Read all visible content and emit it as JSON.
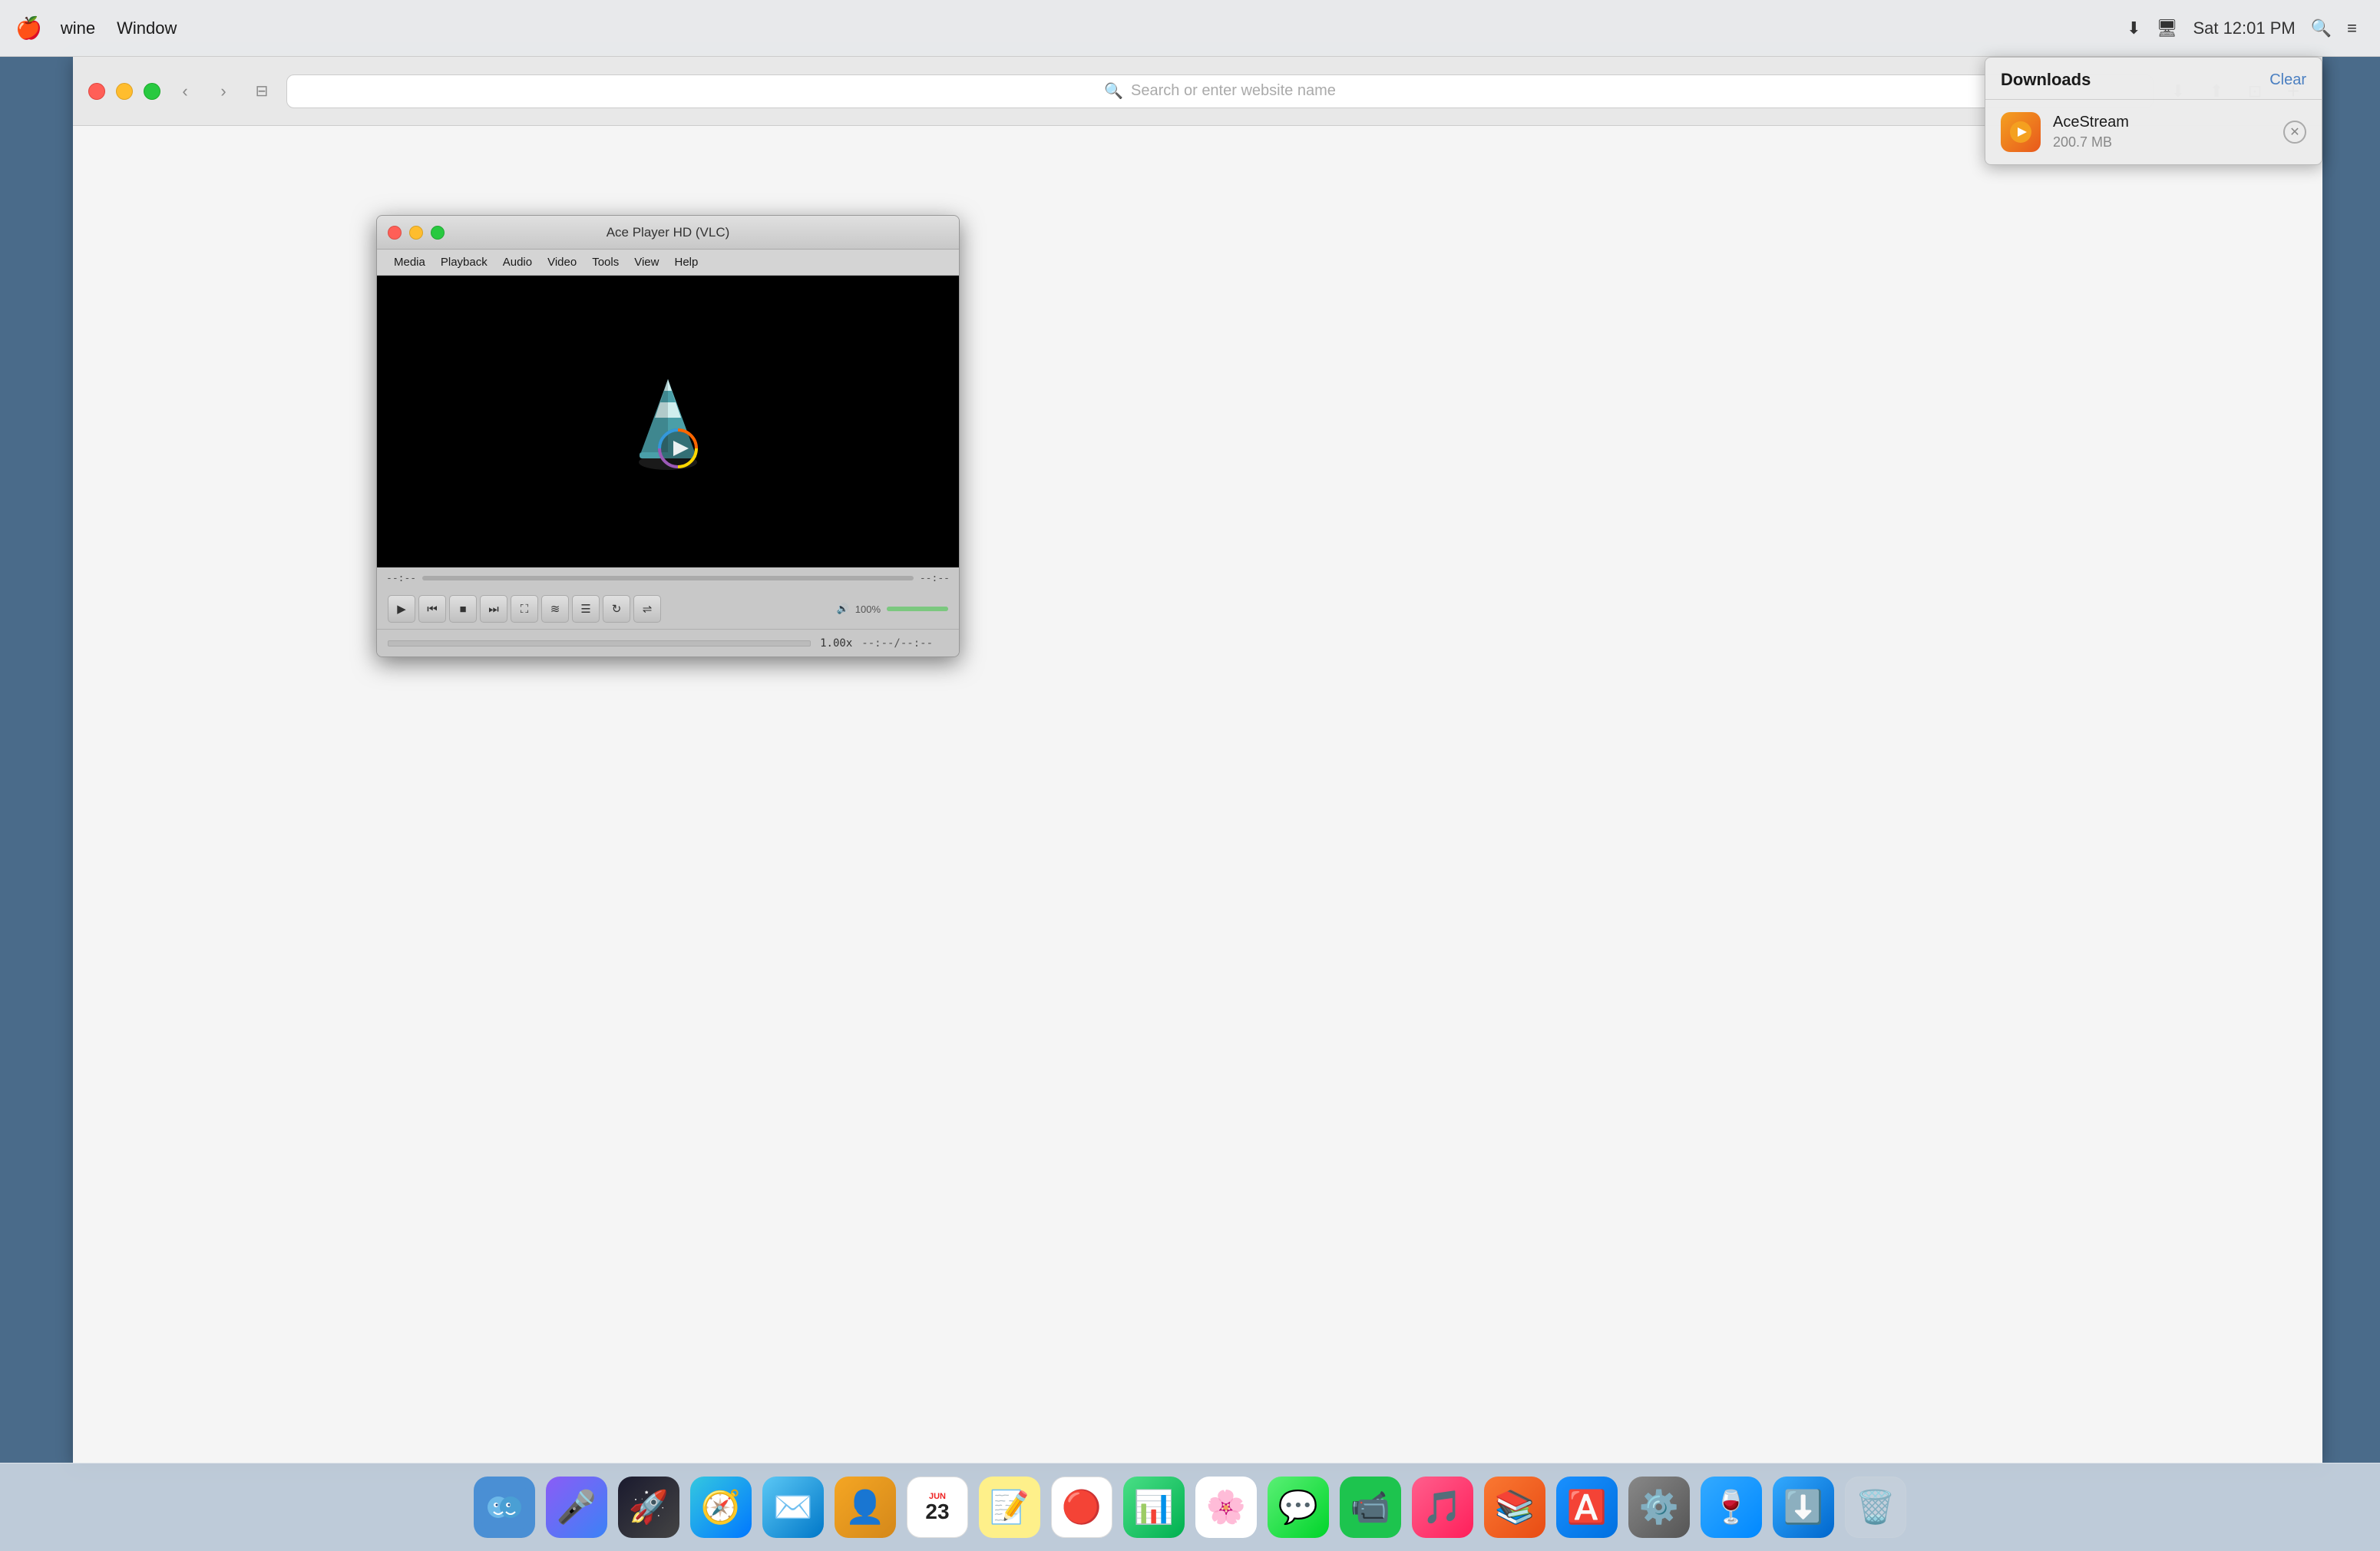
{
  "menubar": {
    "apple": "🍎",
    "app_name": "wine",
    "window_menu": "Window",
    "time": "Sat 12:01 PM"
  },
  "browser": {
    "address_bar_placeholder": "Search or enter website name",
    "back_arrow": "‹",
    "forward_arrow": "›",
    "sidebar_icon": "⊞"
  },
  "downloads": {
    "title": "Downloads",
    "clear_label": "Clear",
    "item_name": "AceStream",
    "item_size": "200.7 MB"
  },
  "vlc": {
    "title": "Ace Player HD (VLC)",
    "menu_items": [
      "Media",
      "Playback",
      "Audio",
      "Video",
      "Tools",
      "View",
      "Help"
    ],
    "seek_left": "--:--",
    "seek_right": "--:--",
    "volume_label": "100%",
    "speed": "1.00x",
    "time": "--:--/--:--"
  },
  "dock": {
    "items": [
      {
        "name": "Finder",
        "icon": "🔵"
      },
      {
        "name": "Siri",
        "icon": "🔮"
      },
      {
        "name": "Launchpad",
        "icon": "🚀"
      },
      {
        "name": "Safari",
        "icon": "🧭"
      },
      {
        "name": "Mail",
        "icon": "✉️"
      },
      {
        "name": "Contacts",
        "icon": "📒"
      },
      {
        "name": "Calendar",
        "icon": "📅"
      },
      {
        "name": "Notes",
        "icon": "📝"
      },
      {
        "name": "Reminders",
        "icon": "🔴"
      },
      {
        "name": "Slideshow",
        "icon": "📊"
      },
      {
        "name": "Photos",
        "icon": "🌸"
      },
      {
        "name": "Messages",
        "icon": "💬"
      },
      {
        "name": "FaceTime",
        "icon": "📹"
      },
      {
        "name": "Music",
        "icon": "🎵"
      },
      {
        "name": "Books",
        "icon": "📚"
      },
      {
        "name": "App Store",
        "icon": "🅰️"
      },
      {
        "name": "System Preferences",
        "icon": "⚙️"
      },
      {
        "name": "Wine",
        "icon": "🍷"
      },
      {
        "name": "Finder Downloads",
        "icon": "⬇️"
      },
      {
        "name": "Trash",
        "icon": "🗑️"
      }
    ]
  }
}
